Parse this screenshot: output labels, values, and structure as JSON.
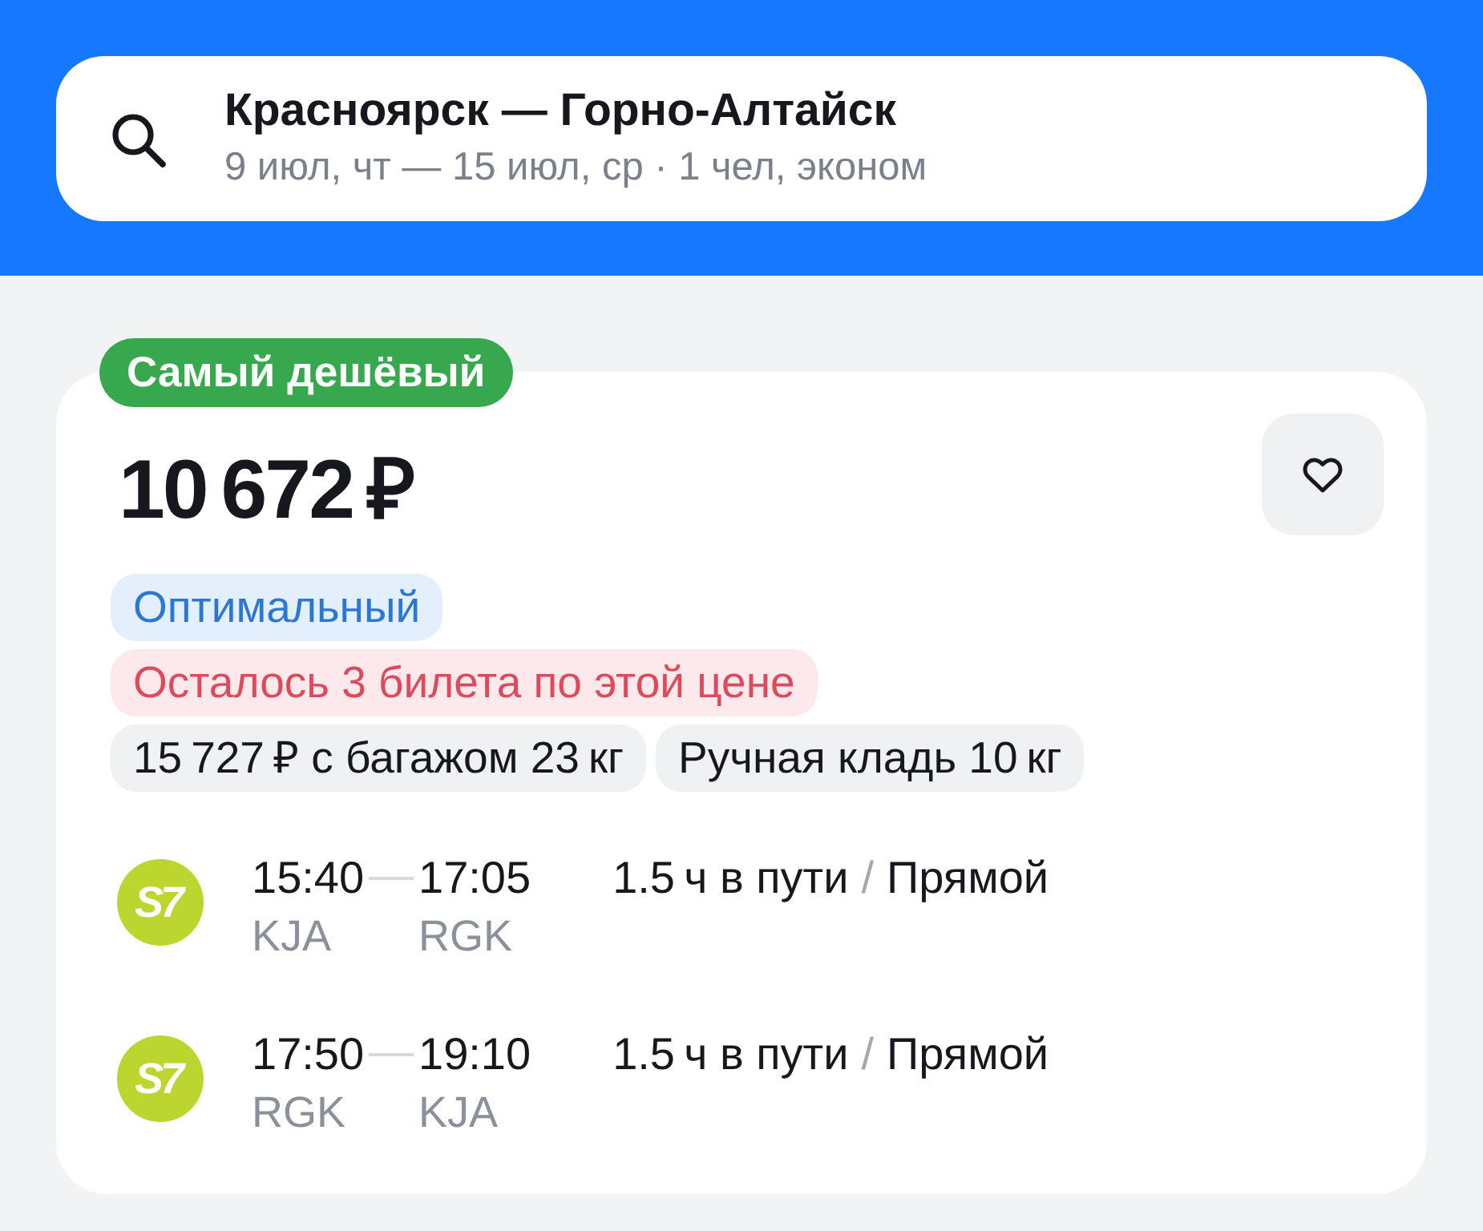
{
  "search": {
    "route": "Красноярск — Горно-Алтайск",
    "details": "9 июл, чт — 15 июл, ср · 1 чел, эконом"
  },
  "offer": {
    "badge": "Самый дешёвый",
    "price": "10 672 ₽",
    "favorite": false,
    "tag_rows": [
      [
        {
          "kind": "info",
          "text": "Оптимальный"
        }
      ],
      [
        {
          "kind": "warning",
          "text": "Осталось 3 билета по этой цене"
        }
      ],
      [
        {
          "kind": "neutral",
          "text": "15 727 ₽ с багажом 23 кг"
        },
        {
          "kind": "neutral",
          "text": "Ручная кладь 10 кг"
        }
      ]
    ],
    "legs": [
      {
        "airline_logo": "S7",
        "depart_time": "15:40",
        "arrive_time": "17:05",
        "depart_code": "KJA",
        "arrive_code": "RGK",
        "duration": "1.5 ч в пути",
        "separator": "/",
        "stops": "Прямой"
      },
      {
        "airline_logo": "S7",
        "depart_time": "17:50",
        "arrive_time": "19:10",
        "depart_code": "RGK",
        "arrive_code": "KJA",
        "duration": "1.5 ч в пути",
        "separator": "/",
        "stops": "Прямой"
      }
    ]
  }
}
